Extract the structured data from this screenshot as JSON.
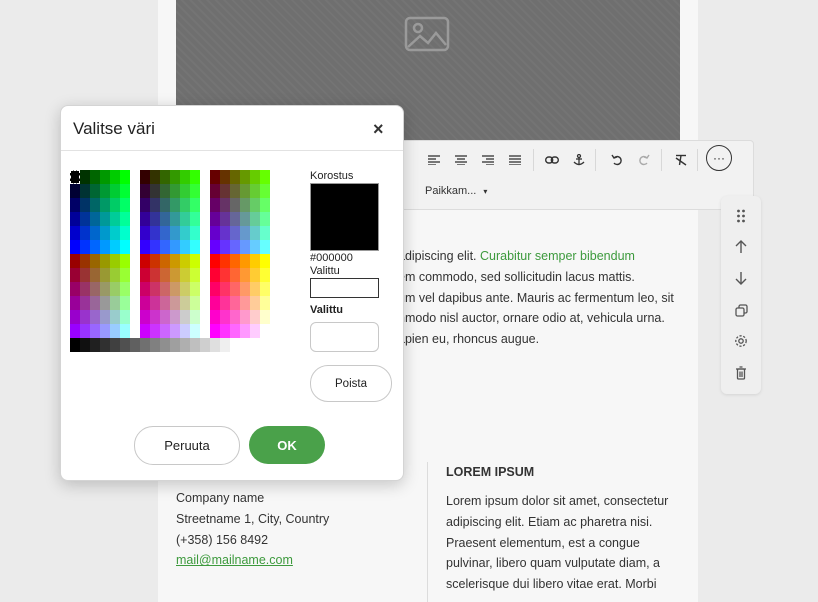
{
  "toolbar": {
    "icons": [
      "align-left-icon",
      "align-center-icon",
      "align-right-icon",
      "align-justify-icon",
      "link-icon",
      "anchor-icon",
      "undo-icon",
      "redo-icon",
      "clear-format-icon",
      "more-icon"
    ],
    "dropdown_label": "Paikkam...",
    "more_label": "···"
  },
  "side_toolbar": {
    "icons": [
      "drag-handle-icon",
      "arrow-up-icon",
      "arrow-down-icon",
      "duplicate-icon",
      "settings-icon",
      "trash-icon"
    ]
  },
  "content": {
    "line1a": "adipiscing elit. ",
    "line1b": "Curabitur semper bibendum",
    "line2": "em commodo, sed sollicitudin lacus mattis.",
    "line3": "um vel dapibus ante. Mauris ac fermentum leo, sit",
    "line4": "nmodo nisl auctor, ornare odio at, vehicula urna.",
    "line5": "apien eu, rhoncus augue."
  },
  "footer": {
    "company": "Company name",
    "street": "Streetname 1, City, Country",
    "phone": "(+358) 156 8492",
    "email": "mail@mailname.com",
    "lorem_heading": "LOREM IPSUM",
    "lorem_lines": [
      "Lorem ipsum dolor sit amet, consectetur",
      "adipiscing elit. Etiam ac pharetra nisi.",
      "Praesent elementum, est a congue",
      "pulvinar, libero quam vulputate diam, a",
      "scelerisque dui libero vitae erat. Morbi"
    ]
  },
  "dialog": {
    "title": "Valitse väri",
    "close_label": "×",
    "highlight_label": "Korostus",
    "preview_color": "#000000",
    "hex_value": "#000000",
    "selected_label_1": "Valittu",
    "selected_label_2": "Valittu",
    "remove_label": "Poista",
    "cancel_label": "Peruuta",
    "ok_label": "OK"
  },
  "colors": {
    "accent_green": "#4aa14a",
    "link_green": "#3d9a3d"
  }
}
